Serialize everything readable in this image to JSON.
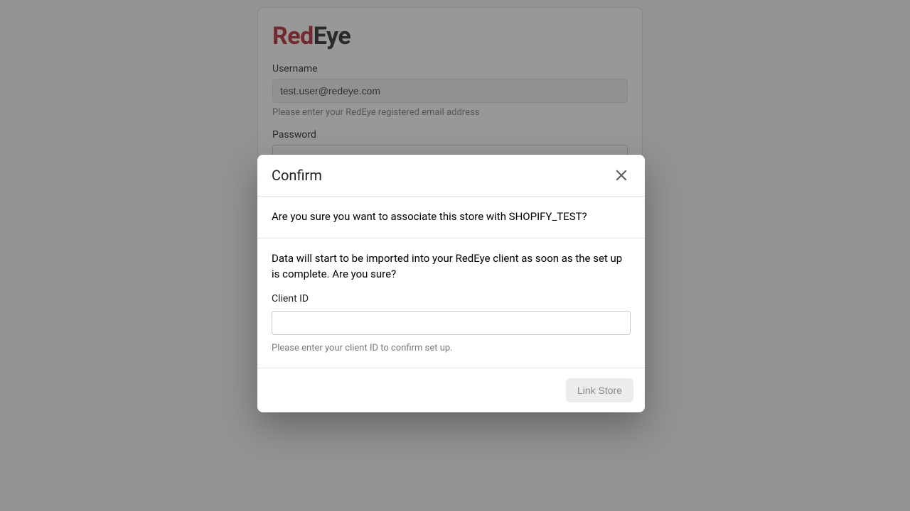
{
  "logo": {
    "part1": "Red",
    "part2": "Eye"
  },
  "login": {
    "username_label": "Username",
    "username_value": "test.user@redeye.com",
    "username_hint": "Please enter your RedEye registered email address",
    "password_label": "Password",
    "password_value": "•"
  },
  "modal": {
    "title": "Confirm",
    "question": "Are you sure you want to associate this store with SHOPIFY_TEST?",
    "warning": "Data will start to be imported into your RedEye client as soon as the set up is complete. Are you sure?",
    "client_id_label": "Client ID",
    "client_id_value": "",
    "client_id_hint": "Please enter your client ID to confirm set up.",
    "submit_label": "Link Store"
  }
}
